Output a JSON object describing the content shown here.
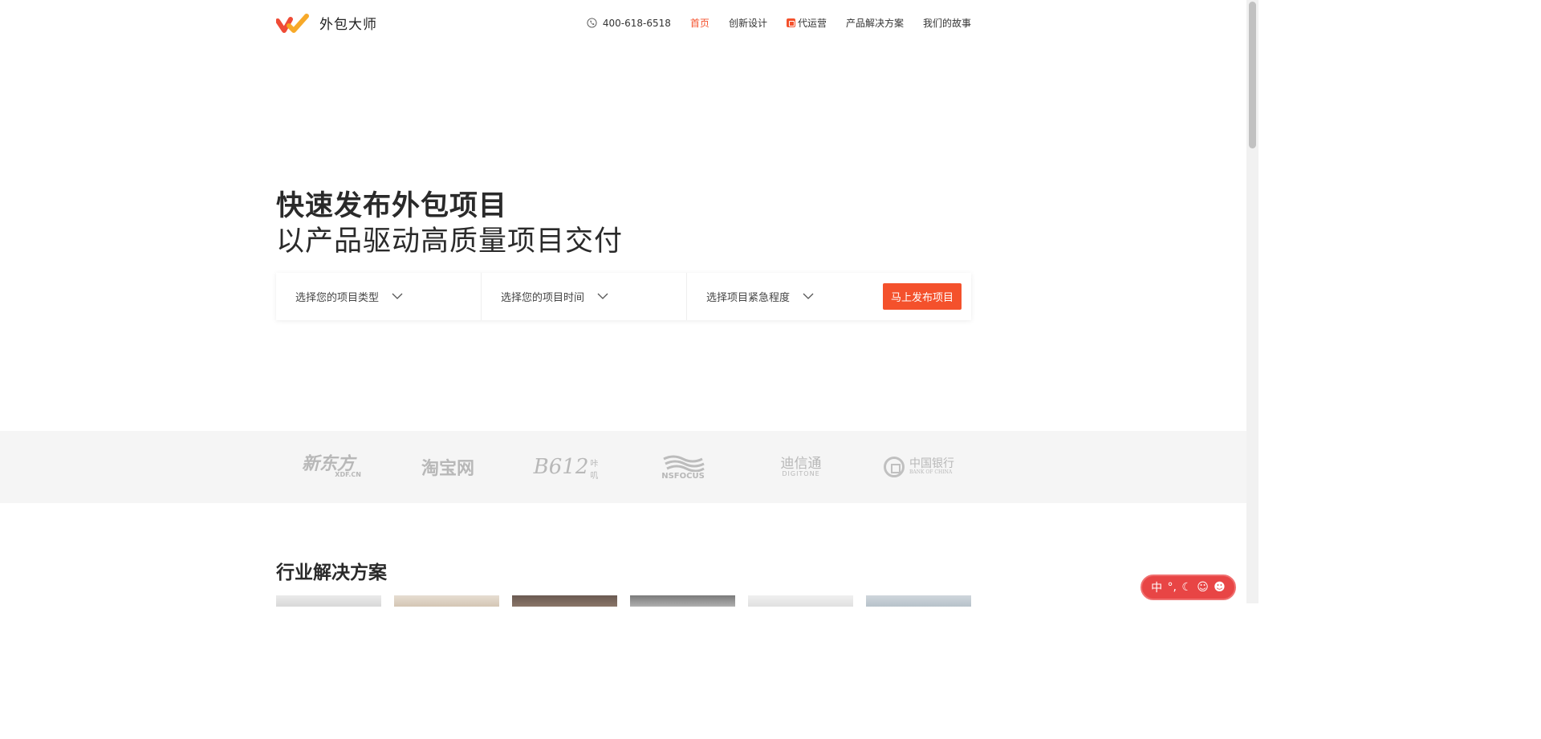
{
  "header": {
    "brand": "外包大师",
    "phone": "400-618-6518",
    "nav": [
      {
        "label": "首页",
        "active": true
      },
      {
        "label": "创新设计",
        "active": false
      },
      {
        "label": "代运营",
        "active": false,
        "badge": true
      },
      {
        "label": "产品解决方案",
        "active": false
      },
      {
        "label": "我们的故事",
        "active": false
      }
    ]
  },
  "hero": {
    "title": "快速发布外包项目",
    "subtitle": "以产品驱动高质量项目交付",
    "selects": [
      "选择您的项目类型",
      "选择您的项目时间",
      "选择项目紧急程度"
    ],
    "cta": "马上发布项目"
  },
  "clients": {
    "xdf": {
      "main": "新东方",
      "sub": "XDF.CN"
    },
    "taobao": "淘宝网",
    "b612": {
      "main": "B612",
      "sub": "咔叽"
    },
    "nsfocus": "NSFOCUS",
    "digitone": {
      "main": "迪信通",
      "sub": "DIGITONE"
    },
    "boc": {
      "main": "中国银行",
      "sub": "BANK OF CHINA"
    }
  },
  "section": {
    "title": "行业解决方案"
  },
  "ime": {
    "mode": "中",
    "punct": "°,"
  },
  "colors": {
    "accent": "#f4512c",
    "logo_red": "#ef4b36",
    "logo_orange": "#f7a41d"
  }
}
